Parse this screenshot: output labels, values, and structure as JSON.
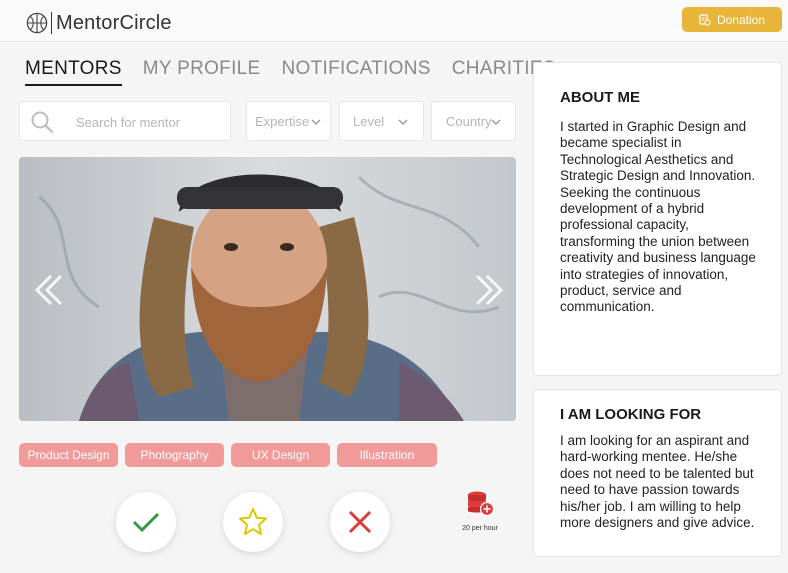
{
  "app": {
    "name": "MentorCircle",
    "logo_icon": "basketball-icon"
  },
  "header": {
    "donate_label": "Donation",
    "donate_icon": "donation-icon",
    "accent": "#e6b53a"
  },
  "tabs": [
    {
      "label": "MENTORS",
      "active": true
    },
    {
      "label": "MY PROFILE",
      "active": false
    },
    {
      "label": "NOTIFICATIONS",
      "active": false
    },
    {
      "label": "CHARITIES",
      "active": false
    }
  ],
  "filters": {
    "search_placeholder": "Search for mentor",
    "expertise": "Expertise",
    "level": "Level",
    "country": "Country"
  },
  "tags": [
    "Product Design",
    "Photography",
    "UX Design",
    "Illustration"
  ],
  "tag_color": "#f29a9a",
  "actions": {
    "accept_icon": "check-icon",
    "favorite_icon": "star-icon",
    "reject_icon": "close-icon"
  },
  "rate": {
    "label": "20 per hour",
    "icon": "coin-stack-add-icon"
  },
  "about": {
    "title": "ABOUT ME",
    "text": "I started in Graphic Design and became specialist in Technological Aesthetics and Strategic Design and Innovation. Seeking the continuous development of a hybrid professional capacity, transforming the union between creativity and business language into strategies of innovation, product, service and communication."
  },
  "looking_for": {
    "title": "I AM LOOKING FOR",
    "text": "I am looking for an aspirant and hard-working mentee. He/she does not need to be talented but need to have passion towards his/her job. I am willing to help more designers and give advice."
  }
}
